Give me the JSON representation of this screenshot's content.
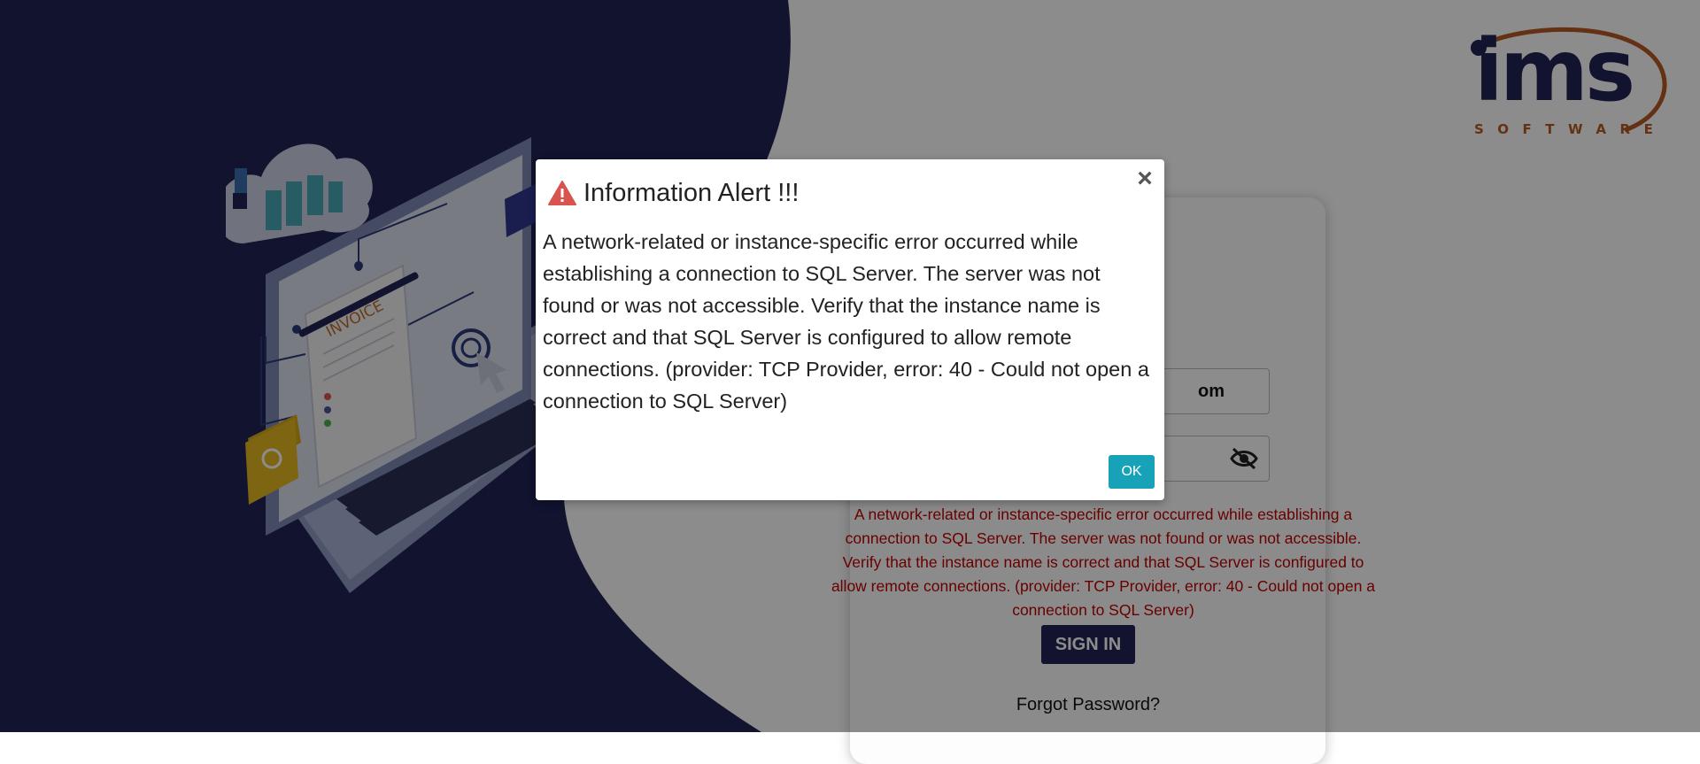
{
  "brand": {
    "logo_main": "ims",
    "logo_sub": "SOFTWARE"
  },
  "illustration": {
    "invoice_label": "INVOICE"
  },
  "login": {
    "username_value": "om",
    "error_message": "A network-related or instance-specific error occurred while establishing a connection to SQL Server. The server was not found or was not accessible. Verify that the instance name is correct and that SQL Server is configured to allow remote connections. (provider: TCP Provider, error: 40 - Could not open a connection to SQL Server)",
    "signin_label": "SIGN IN",
    "forgot_label": "Forgot Password?"
  },
  "modal": {
    "title": "Information Alert !!!",
    "close_glyph": "×",
    "message": "A network-related or instance-specific error occurred while establishing a connection to SQL Server. The server was not found or was not accessible. Verify that the instance name is correct and that SQL Server is configured to allow remote connections. (provider: TCP Provider, error: 40 - Could not open a connection to SQL Server)",
    "ok_label": "OK"
  },
  "colors": {
    "navy": "#1f2456",
    "accent_orange": "#b85a25",
    "error_red": "#c00000",
    "ok_teal": "#17a2b8",
    "warning_icon": "#d9534f"
  },
  "icons": {
    "warning": "warning-triangle-icon",
    "close": "close-icon",
    "password_toggle": "eye-slash-icon"
  }
}
